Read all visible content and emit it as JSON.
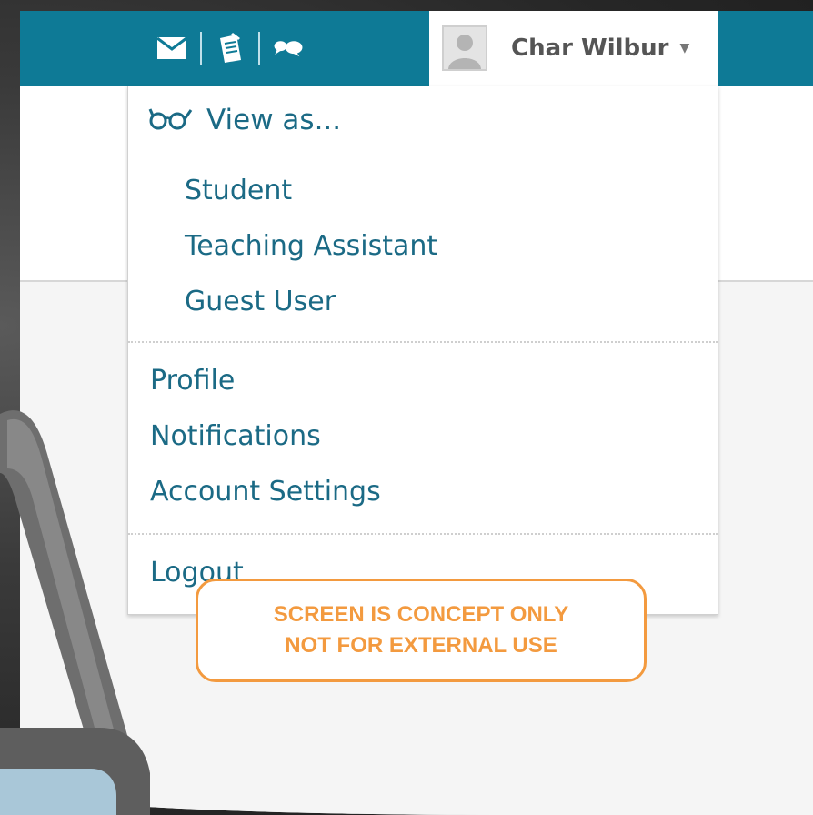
{
  "header": {
    "icons": [
      "mail-icon",
      "clipboard-icon",
      "chat-bubbles-icon"
    ],
    "user": {
      "name": "Char Wilbur",
      "caret": "▼"
    }
  },
  "menu": {
    "view_as": {
      "label": "View as...",
      "icon": "glasses-icon",
      "options": [
        "Student",
        "Teaching Assistant",
        "Guest User"
      ]
    },
    "items": [
      "Profile",
      "Notifications",
      "Account Settings"
    ],
    "logout": "Logout"
  },
  "watermark": {
    "line1": "SCREEN IS CONCEPT ONLY",
    "line2": "NOT FOR EXTERNAL USE"
  },
  "colors": {
    "topbar": "#0e7a96",
    "link": "#1b6a85",
    "watermark": "#f39a3f"
  }
}
